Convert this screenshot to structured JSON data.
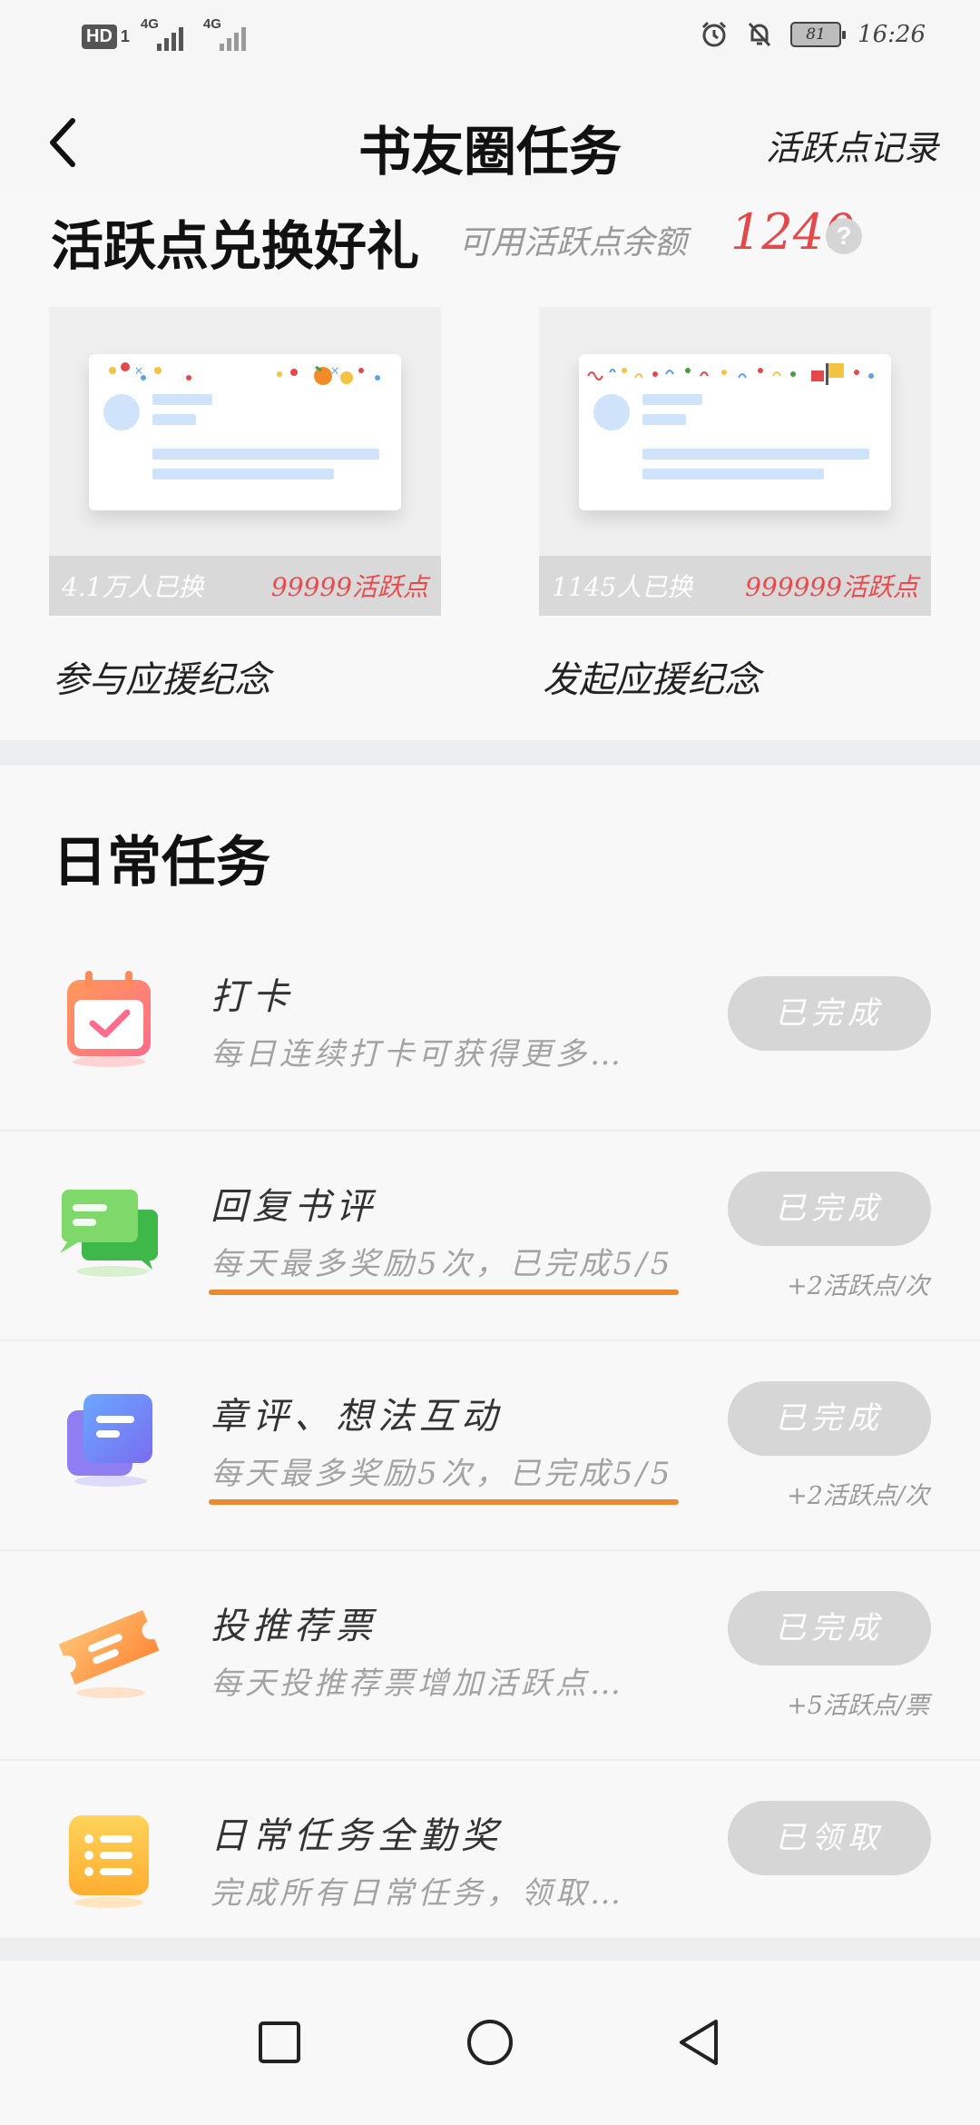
{
  "status_bar": {
    "hd_label": "HD",
    "sim_index": "1",
    "signal_1_label": "4G",
    "signal_2_label": "4G",
    "battery": "81",
    "time": "16:26"
  },
  "nav": {
    "title": "书友圈任务",
    "right_link": "活跃点记录"
  },
  "exchange": {
    "title": "活跃点兑换好礼",
    "balance_label": "可用活跃点余额",
    "balance": "1240",
    "help": "?",
    "gifts": [
      {
        "count": "4.1万人已换",
        "price": "99999活跃点",
        "name": "参与应援纪念"
      },
      {
        "count": "1145人已换",
        "price": "999999活跃点",
        "name": "发起应援纪念"
      }
    ]
  },
  "daily": {
    "title": "日常任务",
    "tasks": [
      {
        "name": "打卡",
        "desc": "每日连续打卡可获得更多…",
        "button": "已完成",
        "note": ""
      },
      {
        "name": "回复书评",
        "desc": "每天最多奖励5次，已完成5/5",
        "button": "已完成",
        "note": "+2活跃点/次"
      },
      {
        "name": "章评、想法互动",
        "desc": "每天最多奖励5次，已完成5/5",
        "button": "已完成",
        "note": "+2活跃点/次"
      },
      {
        "name": "投推荐票",
        "desc": "每天投推荐票增加活跃点…",
        "button": "已完成",
        "note": "+5活跃点/票"
      },
      {
        "name": "日常任务全勤奖",
        "desc": "完成所有日常任务，领取…",
        "button": "已领取",
        "note": ""
      }
    ]
  },
  "colors": {
    "accent_red": "#e4484a",
    "underline_orange": "#ec8a30",
    "button_gray": "#d6d6d6"
  },
  "icons": [
    "back-arrow-icon",
    "help-icon",
    "calendar-check-icon",
    "chat-bubbles-icon",
    "note-cards-icon",
    "ticket-icon",
    "list-icon",
    "square-nav-icon",
    "circle-nav-icon",
    "triangle-back-nav-icon",
    "alarm-icon",
    "mute-bell-icon"
  ]
}
